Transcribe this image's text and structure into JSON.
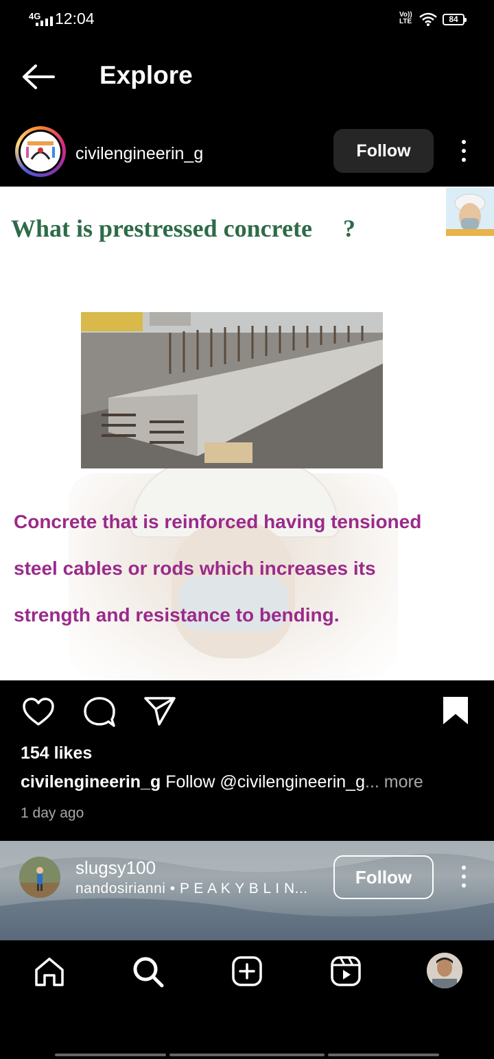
{
  "status_bar": {
    "network": "4G",
    "time": "12:04",
    "volte_line1": "Vo))",
    "volte_line2": "LTE",
    "battery": "84"
  },
  "header": {
    "title": "Explore"
  },
  "post": {
    "username": "civilengineerin_g",
    "follow_label": "Follow",
    "image": {
      "heading": "What is prestressed concrete",
      "heading_mark": "?",
      "body_lines": [
        "Concrete that is reinforced having tensioned",
        "steel cables or rods which increases its",
        "strength and resistance to bending."
      ]
    },
    "likes": "154 likes",
    "caption_user": "civilengineerin_g",
    "caption_text": " Follow @civilengineerin_g",
    "caption_more": "... more",
    "time_ago": "1 day ago",
    "saved": true
  },
  "next_post": {
    "username": "slugsy100",
    "subtitle": "nandosirianni • P E A K Y  B L I N...",
    "follow_label": "Follow"
  },
  "bottom_nav": {
    "items": [
      "home-icon",
      "search-icon",
      "create-icon",
      "reels-icon",
      "profile-avatar"
    ],
    "active": "search"
  },
  "colors": {
    "post_heading": "#2e6b48",
    "post_body": "#9b2a8a",
    "follow_bg": "#262626",
    "muted_text": "#a8a8a8"
  }
}
